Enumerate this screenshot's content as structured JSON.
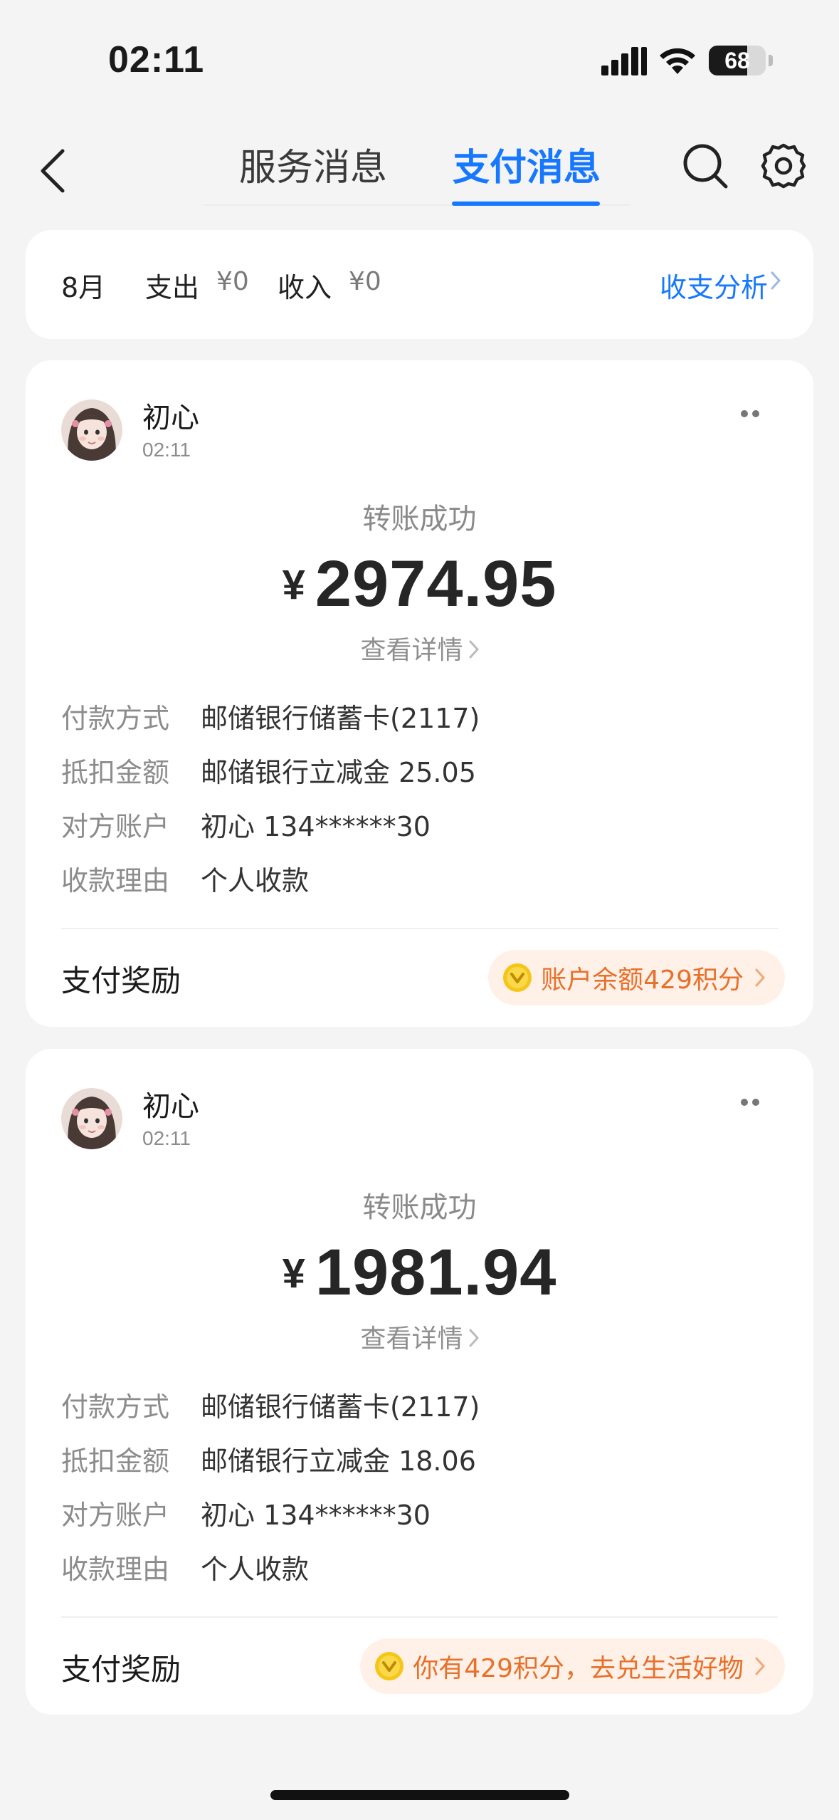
{
  "status_bar": {
    "time": "02:11",
    "battery": "68",
    "battery_level": 0.68
  },
  "nav": {
    "tabs": [
      {
        "label": "服务消息",
        "active": false
      },
      {
        "label": "支付消息",
        "active": true
      }
    ],
    "accent_color": "#1677ff"
  },
  "summary": {
    "month": "8月",
    "expense_label": "支出",
    "expense_value": "¥0",
    "income_label": "收入",
    "income_value": "¥0",
    "analysis_link": "收支分析"
  },
  "cards": [
    {
      "sender": "初心",
      "time": "02:11",
      "status": "转账成功",
      "currency": "¥",
      "amount": "2974.95",
      "detail_link": "查看详情",
      "rows": [
        {
          "label": "付款方式",
          "value": "邮储银行储蓄卡(2117)"
        },
        {
          "label": "抵扣金额",
          "value": "邮储银行立减金 25.05"
        },
        {
          "label": "对方账户",
          "value": "初心 134******30"
        },
        {
          "label": "收款理由",
          "value": "个人收款"
        }
      ],
      "reward_label": "支付奖励",
      "reward_text": "账户余额429积分"
    },
    {
      "sender": "初心",
      "time": "02:11",
      "status": "转账成功",
      "currency": "¥",
      "amount": "1981.94",
      "detail_link": "查看详情",
      "rows": [
        {
          "label": "付款方式",
          "value": "邮储银行储蓄卡(2117)"
        },
        {
          "label": "抵扣金额",
          "value": "邮储银行立减金 18.06"
        },
        {
          "label": "对方账户",
          "value": "初心 134******30"
        },
        {
          "label": "收款理由",
          "value": "个人收款"
        }
      ],
      "reward_label": "支付奖励",
      "reward_text": "你有429积分，去兑生活好物"
    }
  ],
  "icons": {
    "back": "back-arrow-icon",
    "search": "search-icon",
    "settings": "gear-icon",
    "more": "more-dots-icon",
    "coin": "coin-icon"
  }
}
